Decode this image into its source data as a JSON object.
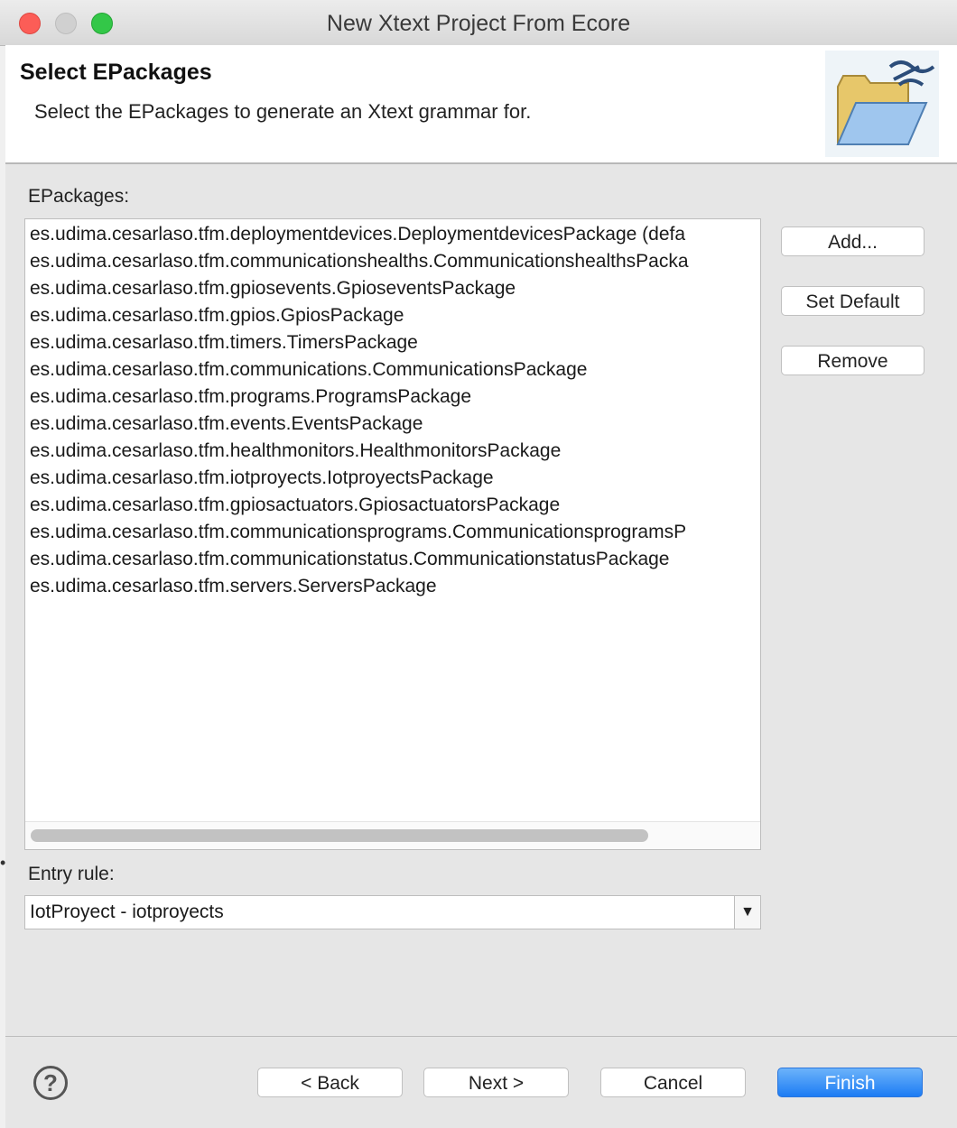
{
  "window": {
    "title": "New Xtext Project From Ecore"
  },
  "banner": {
    "title": "Select EPackages",
    "description": "Select the EPackages to generate an Xtext grammar for.",
    "icon": "folder-xtext-icon"
  },
  "epackages": {
    "label": "EPackages:",
    "items": [
      "es.udima.cesarlaso.tfm.deploymentdevices.DeploymentdevicesPackage (defa",
      "es.udima.cesarlaso.tfm.communicationshealths.CommunicationshealthsPacka",
      "es.udima.cesarlaso.tfm.gpiosevents.GpioseventsPackage",
      "es.udima.cesarlaso.tfm.gpios.GpiosPackage",
      "es.udima.cesarlaso.tfm.timers.TimersPackage",
      "es.udima.cesarlaso.tfm.communications.CommunicationsPackage",
      "es.udima.cesarlaso.tfm.programs.ProgramsPackage",
      "es.udima.cesarlaso.tfm.events.EventsPackage",
      "es.udima.cesarlaso.tfm.healthmonitors.HealthmonitorsPackage",
      "es.udima.cesarlaso.tfm.iotproyects.IotproyectsPackage",
      "es.udima.cesarlaso.tfm.gpiosactuators.GpiosactuatorsPackage",
      "es.udima.cesarlaso.tfm.communicationsprograms.CommunicationsprogramsP",
      "es.udima.cesarlaso.tfm.communicationstatus.CommunicationstatusPackage",
      "es.udima.cesarlaso.tfm.servers.ServersPackage"
    ]
  },
  "buttons": {
    "add": "Add...",
    "set_default": "Set Default",
    "remove": "Remove"
  },
  "entry_rule": {
    "label": "Entry rule:",
    "value": "IotProyect - iotproyects"
  },
  "footer": {
    "back": "< Back",
    "next": "Next >",
    "cancel": "Cancel",
    "finish": "Finish"
  },
  "colors": {
    "accent": "#1c7cf4",
    "close": "#fc5d57",
    "maximize": "#33c748"
  }
}
